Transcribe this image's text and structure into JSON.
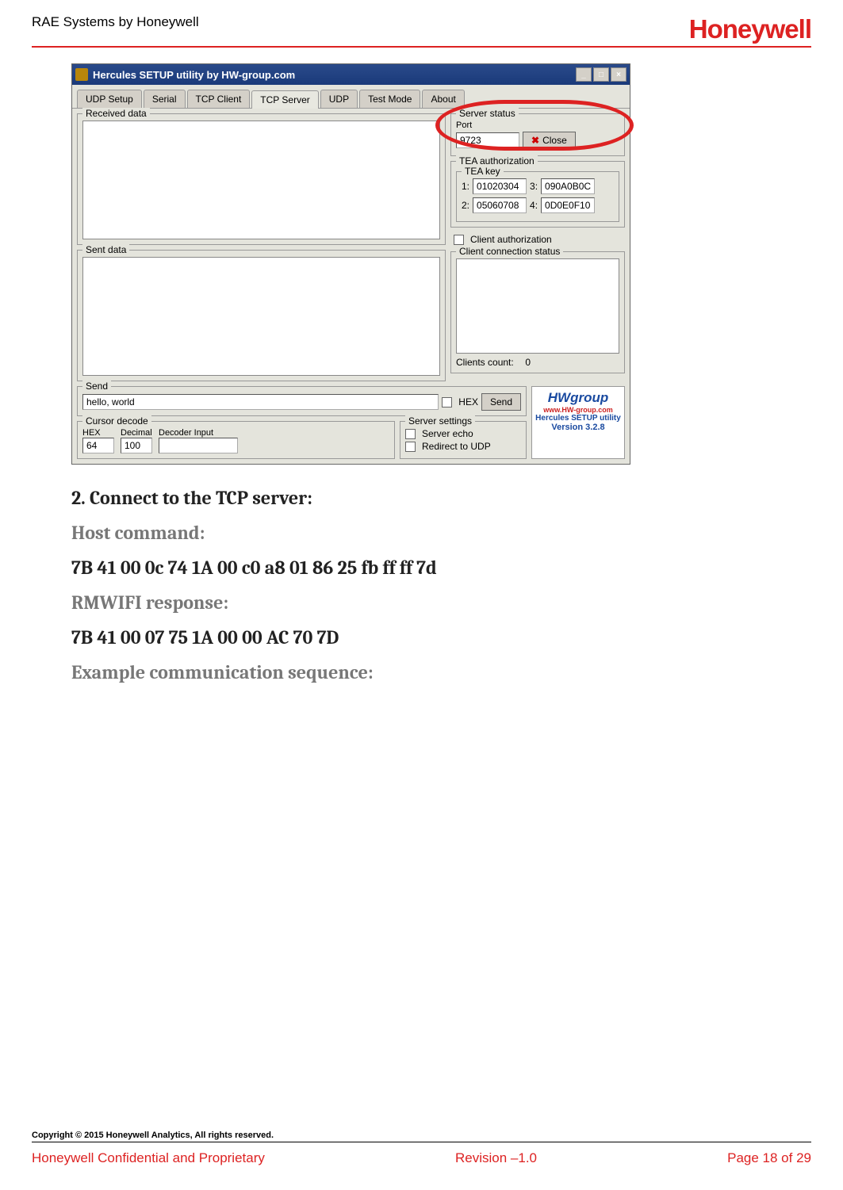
{
  "header": {
    "left": "RAE Systems by Honeywell",
    "logo": "Honeywell"
  },
  "win": {
    "title": "Hercules SETUP utility by HW-group.com",
    "tabs": [
      "UDP Setup",
      "Serial",
      "TCP Client",
      "TCP Server",
      "UDP",
      "Test Mode",
      "About"
    ],
    "active_tab": "TCP Server",
    "received_label": "Received data",
    "sent_label": "Sent data",
    "server_status": {
      "label": "Server status",
      "port_label": "Port",
      "port_value": "9723",
      "close_btn": "Close"
    },
    "tea": {
      "label": "TEA authorization",
      "key_label": "TEA key",
      "k1": "01020304",
      "k2": "05060708",
      "k3": "090A0B0C",
      "k4": "0D0E0F10"
    },
    "client_auth": "Client authorization",
    "client_conn": {
      "label": "Client connection status",
      "count_label": "Clients count:",
      "count_value": "0"
    },
    "send": {
      "label": "Send",
      "value": "hello, world",
      "hex": "HEX",
      "btn": "Send"
    },
    "cursor": {
      "label": "Cursor decode",
      "hex_label": "HEX",
      "hex_val": "64",
      "dec_label": "Decimal",
      "dec_val": "100",
      "dinput_label": "Decoder Input"
    },
    "srv_settings": {
      "label": "Server settings",
      "echo": "Server echo",
      "redirect": "Redirect to UDP"
    },
    "hw": {
      "name": "HWgroup",
      "link": "www.HW-group.com",
      "util": "Hercules SETUP utility",
      "ver": "Version  3.2.8"
    }
  },
  "content": {
    "l1": "2. Connect to the TCP server:",
    "l2": "Host command:",
    "l3": "7B 41 00 0c 74 1A 00 c0 a8 01 86 25 fb ff ff 7d",
    "l4": "RMWIFI response:",
    "l5": "7B 41 00 07 75 1A 00 00 AC 70 7D",
    "l6": "Example communication sequence:"
  },
  "footer": {
    "copyright": "Copyright © 2015 Honeywell Analytics, All rights reserved.",
    "left": "Honeywell Confidential and Proprietary",
    "center": "Revision –1.0",
    "right": "Page 18 of 29"
  }
}
